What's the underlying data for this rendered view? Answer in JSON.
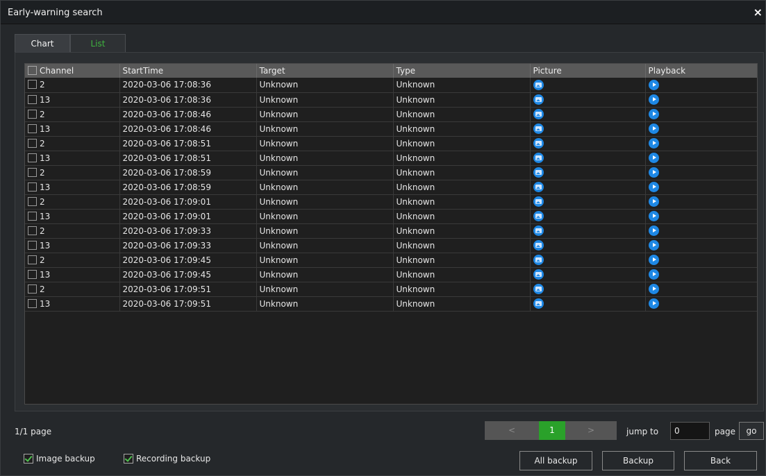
{
  "window": {
    "title": "Early-warning search",
    "close_symbol": "×"
  },
  "tabs": [
    {
      "label": "Chart",
      "active": false
    },
    {
      "label": "List",
      "active": true
    }
  ],
  "table": {
    "columns": [
      "Channel",
      "StartTime",
      "Target",
      "Type",
      "Picture",
      "Playback"
    ],
    "rows": [
      {
        "channel": "2",
        "start_time": "2020-03-06 17:08:36",
        "target": "Unknown",
        "type": "Unknown"
      },
      {
        "channel": "13",
        "start_time": "2020-03-06 17:08:36",
        "target": "Unknown",
        "type": "Unknown"
      },
      {
        "channel": "2",
        "start_time": "2020-03-06 17:08:46",
        "target": "Unknown",
        "type": "Unknown"
      },
      {
        "channel": "13",
        "start_time": "2020-03-06 17:08:46",
        "target": "Unknown",
        "type": "Unknown"
      },
      {
        "channel": "2",
        "start_time": "2020-03-06 17:08:51",
        "target": "Unknown",
        "type": "Unknown"
      },
      {
        "channel": "13",
        "start_time": "2020-03-06 17:08:51",
        "target": "Unknown",
        "type": "Unknown"
      },
      {
        "channel": "2",
        "start_time": "2020-03-06 17:08:59",
        "target": "Unknown",
        "type": "Unknown"
      },
      {
        "channel": "13",
        "start_time": "2020-03-06 17:08:59",
        "target": "Unknown",
        "type": "Unknown"
      },
      {
        "channel": "2",
        "start_time": "2020-03-06 17:09:01",
        "target": "Unknown",
        "type": "Unknown"
      },
      {
        "channel": "13",
        "start_time": "2020-03-06 17:09:01",
        "target": "Unknown",
        "type": "Unknown"
      },
      {
        "channel": "2",
        "start_time": "2020-03-06 17:09:33",
        "target": "Unknown",
        "type": "Unknown"
      },
      {
        "channel": "13",
        "start_time": "2020-03-06 17:09:33",
        "target": "Unknown",
        "type": "Unknown"
      },
      {
        "channel": "2",
        "start_time": "2020-03-06 17:09:45",
        "target": "Unknown",
        "type": "Unknown"
      },
      {
        "channel": "13",
        "start_time": "2020-03-06 17:09:45",
        "target": "Unknown",
        "type": "Unknown"
      },
      {
        "channel": "2",
        "start_time": "2020-03-06 17:09:51",
        "target": "Unknown",
        "type": "Unknown"
      },
      {
        "channel": "13",
        "start_time": "2020-03-06 17:09:51",
        "target": "Unknown",
        "type": "Unknown"
      }
    ],
    "picture_icon": "image-icon",
    "playback_icon": "play-icon"
  },
  "pagination": {
    "page_info": "1/1 page",
    "prev_symbol": "<",
    "current_page": "1",
    "next_symbol": ">",
    "jump_label": "jump to",
    "jump_value": "0",
    "page_label": "page",
    "go_label": "go"
  },
  "options": {
    "image_backup": {
      "label": "Image backup",
      "checked": true
    },
    "recording_backup": {
      "label": "Recording backup",
      "checked": true
    }
  },
  "buttons": {
    "all_backup": "All backup",
    "backup": "Backup",
    "back": "Back"
  },
  "colors": {
    "accent_green": "#2aa12a",
    "tab_active_text": "#3fb43f",
    "icon_blue": "#1e88e5",
    "header_gray": "#595959"
  }
}
